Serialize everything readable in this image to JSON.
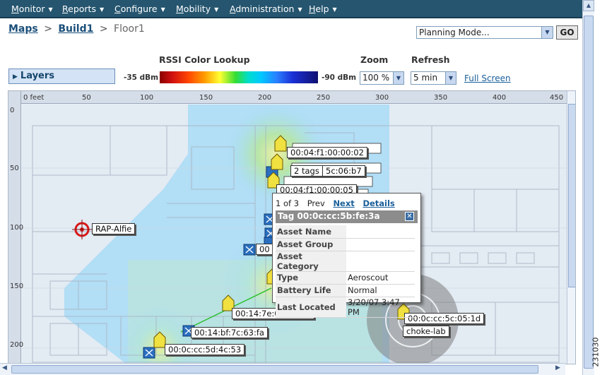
{
  "menu": [
    {
      "underline": "M",
      "rest": "onitor"
    },
    {
      "underline": "R",
      "rest": "eports"
    },
    {
      "underline": "C",
      "rest": "onfigure"
    },
    {
      "underline": "M",
      "rest": "obility"
    },
    {
      "underline": "A",
      "rest": "dministration"
    },
    {
      "underline": "H",
      "rest": "elp"
    }
  ],
  "breadcrumb": {
    "maps": "Maps",
    "building": "Build1",
    "sep": ">",
    "floor": "Floor1"
  },
  "mode_select": {
    "value": "Planning Mode..."
  },
  "go_label": "GO",
  "layers_label": "Layers",
  "rssi": {
    "title": "RSSI Color Lookup",
    "low": "-35 dBm",
    "high": "-90 dBm"
  },
  "zoom": {
    "title": "Zoom",
    "value": "100 %"
  },
  "refresh": {
    "title": "Refresh",
    "value": "5 min"
  },
  "fullscreen_label": "Full Screen",
  "ruler": {
    "x_labels": [
      "0 feet",
      "50",
      "100",
      "150",
      "200",
      "250",
      "300",
      "350",
      "400",
      "450"
    ],
    "y_labels": [
      "0",
      "50",
      "100",
      "150",
      "200"
    ]
  },
  "tags": {
    "t1": "00:04:f1:00:00:02",
    "t2": "2 tags",
    "t2b": "5c:06:b7",
    "t3": "00:04:f1:00:00:05",
    "t4": "00:14:7e:00:05:5a",
    "t5": "00:14:bf:7c:63:fa",
    "t6": "00:0c:cc:5d:4c:53",
    "t7": "00:0c:cc:5c:05:1d",
    "t8": "choke-lab",
    "t9": "00"
  },
  "rap_label": "RAP-Alfie",
  "popup": {
    "counter": "1 of 3",
    "prev": "Prev",
    "next": "Next",
    "details": "Details",
    "title": "Tag 00:0c:cc:5b:fe:3a",
    "rows": [
      {
        "k": "Asset Name",
        "v": ""
      },
      {
        "k": "Asset Group",
        "v": ""
      },
      {
        "k": "Asset Category",
        "v": ""
      },
      {
        "k": "Type",
        "v": "Aeroscout"
      },
      {
        "k": "Battery Life",
        "v": "Normal"
      },
      {
        "k": "Last Located",
        "v": "3/20/07 3:47 PM"
      }
    ]
  },
  "figure_number": "231030",
  "colors": {
    "nav_bg": "#25556f",
    "link": "#1a5f9a",
    "tag_fill": "#f0e040",
    "ap_fill": "#2a6fbf"
  }
}
